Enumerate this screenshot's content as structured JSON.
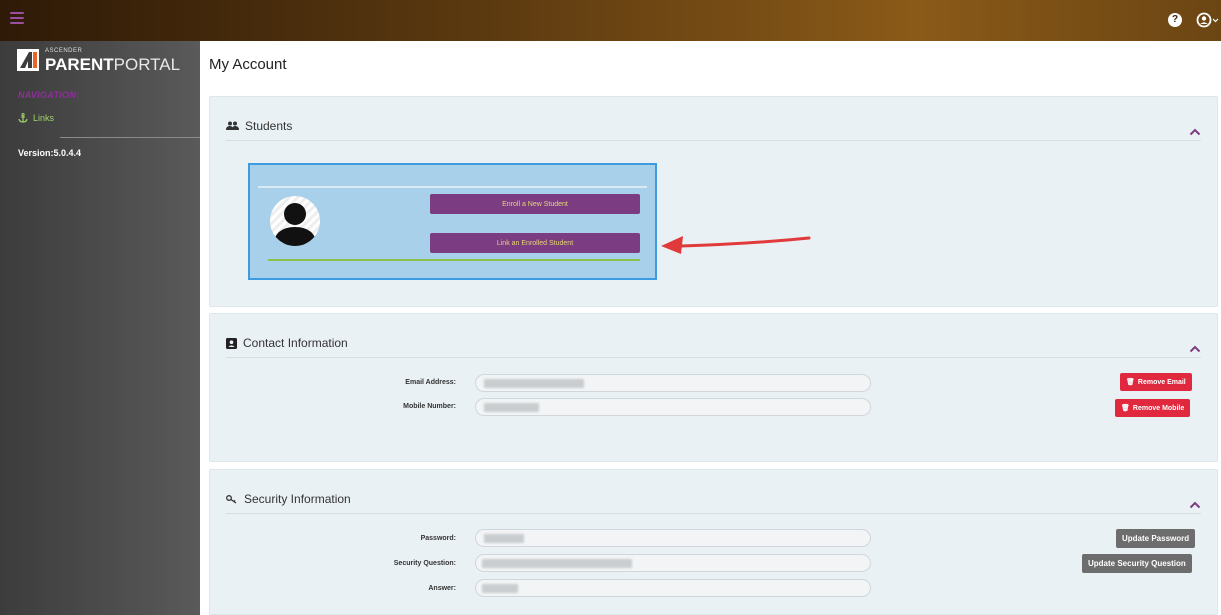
{
  "header": {
    "help_icon": "question-circle-icon",
    "user_icon": "user-circle-icon"
  },
  "sidebar": {
    "logo_small": "ASCENDER",
    "logo_bold": "PARENT",
    "logo_light": "PORTAL",
    "nav_heading": "NAVIGATION:",
    "links_label": "Links",
    "version": "Version:5.0.4.4"
  },
  "main": {
    "page_title": "My Account",
    "students": {
      "title": "Students",
      "enroll_label": "Enroll a New Student",
      "link_label": "Link an Enrolled Student"
    },
    "contact": {
      "title": "Contact Information",
      "email_label": "Email Address:",
      "mobile_label": "Mobile Number:",
      "remove_email": "Remove Email",
      "remove_mobile": "Remove Mobile"
    },
    "security": {
      "title": "Security Information",
      "password_label": "Password:",
      "question_label": "Security Question:",
      "answer_label": "Answer:",
      "update_password": "Update Password",
      "update_question": "Update Security Question"
    }
  },
  "colors": {
    "topbar_start": "#2e1a07",
    "topbar_end": "#8a5a18",
    "nav_heading": "#8e2f9a",
    "nav_link": "#a3d26b",
    "panel_bg": "#eaf1f5",
    "card_bg": "#a8d0ea",
    "card_border": "#3f9be0",
    "button_purple": "#7b3c82",
    "button_purple_text": "#e6d77a",
    "button_red": "#e0293f",
    "button_gray": "#6d6d6d",
    "arrow": "#e03a3a",
    "chevron": "#7b3c82"
  }
}
